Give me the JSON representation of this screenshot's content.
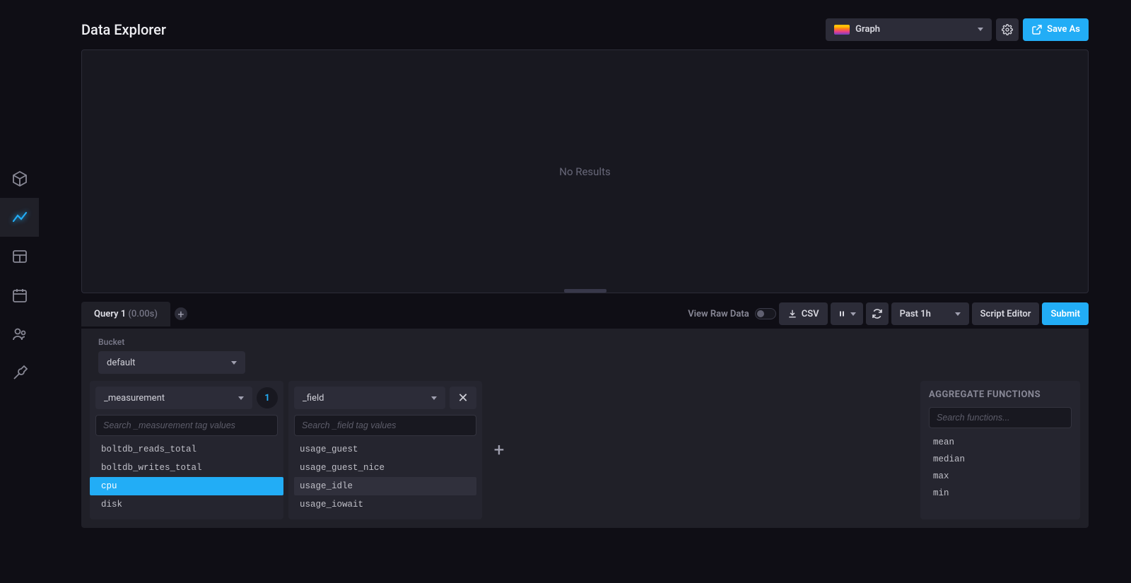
{
  "header": {
    "title": "Data Explorer",
    "vis_type": "Graph",
    "save_as": "Save As"
  },
  "vis": {
    "empty_text": "No Results"
  },
  "querybar": {
    "tab_label": "Query 1",
    "tab_duration": "(0.00s)",
    "view_raw": "View Raw Data",
    "csv": "CSV",
    "time_range": "Past 1h",
    "script_editor": "Script Editor",
    "submit": "Submit"
  },
  "builder": {
    "bucket_label": "Bucket",
    "bucket_value": "default",
    "cards": [
      {
        "key": "_measurement",
        "count": "1",
        "search_placeholder": "Search _measurement tag values",
        "values": [
          {
            "label": "boltdb_reads_total",
            "state": ""
          },
          {
            "label": "boltdb_writes_total",
            "state": ""
          },
          {
            "label": "cpu",
            "state": "selected"
          },
          {
            "label": "disk",
            "state": ""
          }
        ]
      },
      {
        "key": "_field",
        "count": "",
        "search_placeholder": "Search _field tag values",
        "values": [
          {
            "label": "usage_guest",
            "state": ""
          },
          {
            "label": "usage_guest_nice",
            "state": ""
          },
          {
            "label": "usage_idle",
            "state": "hover"
          },
          {
            "label": "usage_iowait",
            "state": ""
          }
        ]
      }
    ],
    "agg": {
      "title": "AGGREGATE FUNCTIONS",
      "search_placeholder": "Search functions...",
      "items": [
        "mean",
        "median",
        "max",
        "min"
      ]
    }
  }
}
